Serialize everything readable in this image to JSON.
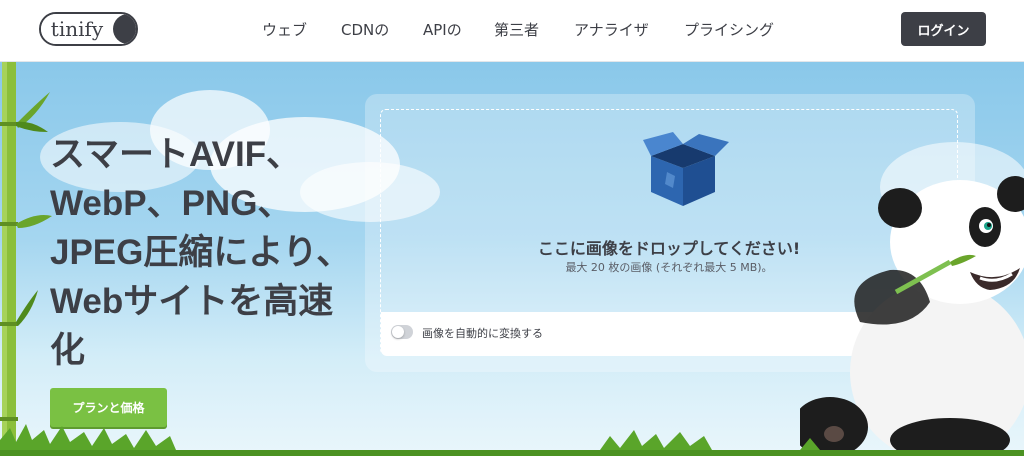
{
  "header": {
    "logo_text": "tinify",
    "nav": [
      {
        "label": "ウェブ"
      },
      {
        "label": "CDNの"
      },
      {
        "label": "APIの"
      },
      {
        "label": "第三者"
      },
      {
        "label": "アナライザ"
      },
      {
        "label": "プライシング"
      }
    ],
    "login_label": "ログイン"
  },
  "hero": {
    "headline_lines": [
      "スマートAVIF、",
      "WebP、PNG、",
      "JPEG圧縮により、",
      "Webサイトを高速",
      "化"
    ],
    "cta_label": "プランと価格"
  },
  "dropzone": {
    "title": "ここに画像をドロップしてください!",
    "subtitle": "最大 20 枚の画像 (それぞれ最大 5 MB)。",
    "auto_convert_label": "画像を自動的に変換する",
    "auto_convert_enabled": false,
    "icon": "open-box-icon"
  },
  "colors": {
    "dark": "#3d3f46",
    "cta_green": "#7ac143",
    "sky": "#a5d6f0",
    "box_blue": "#2d66b0"
  }
}
